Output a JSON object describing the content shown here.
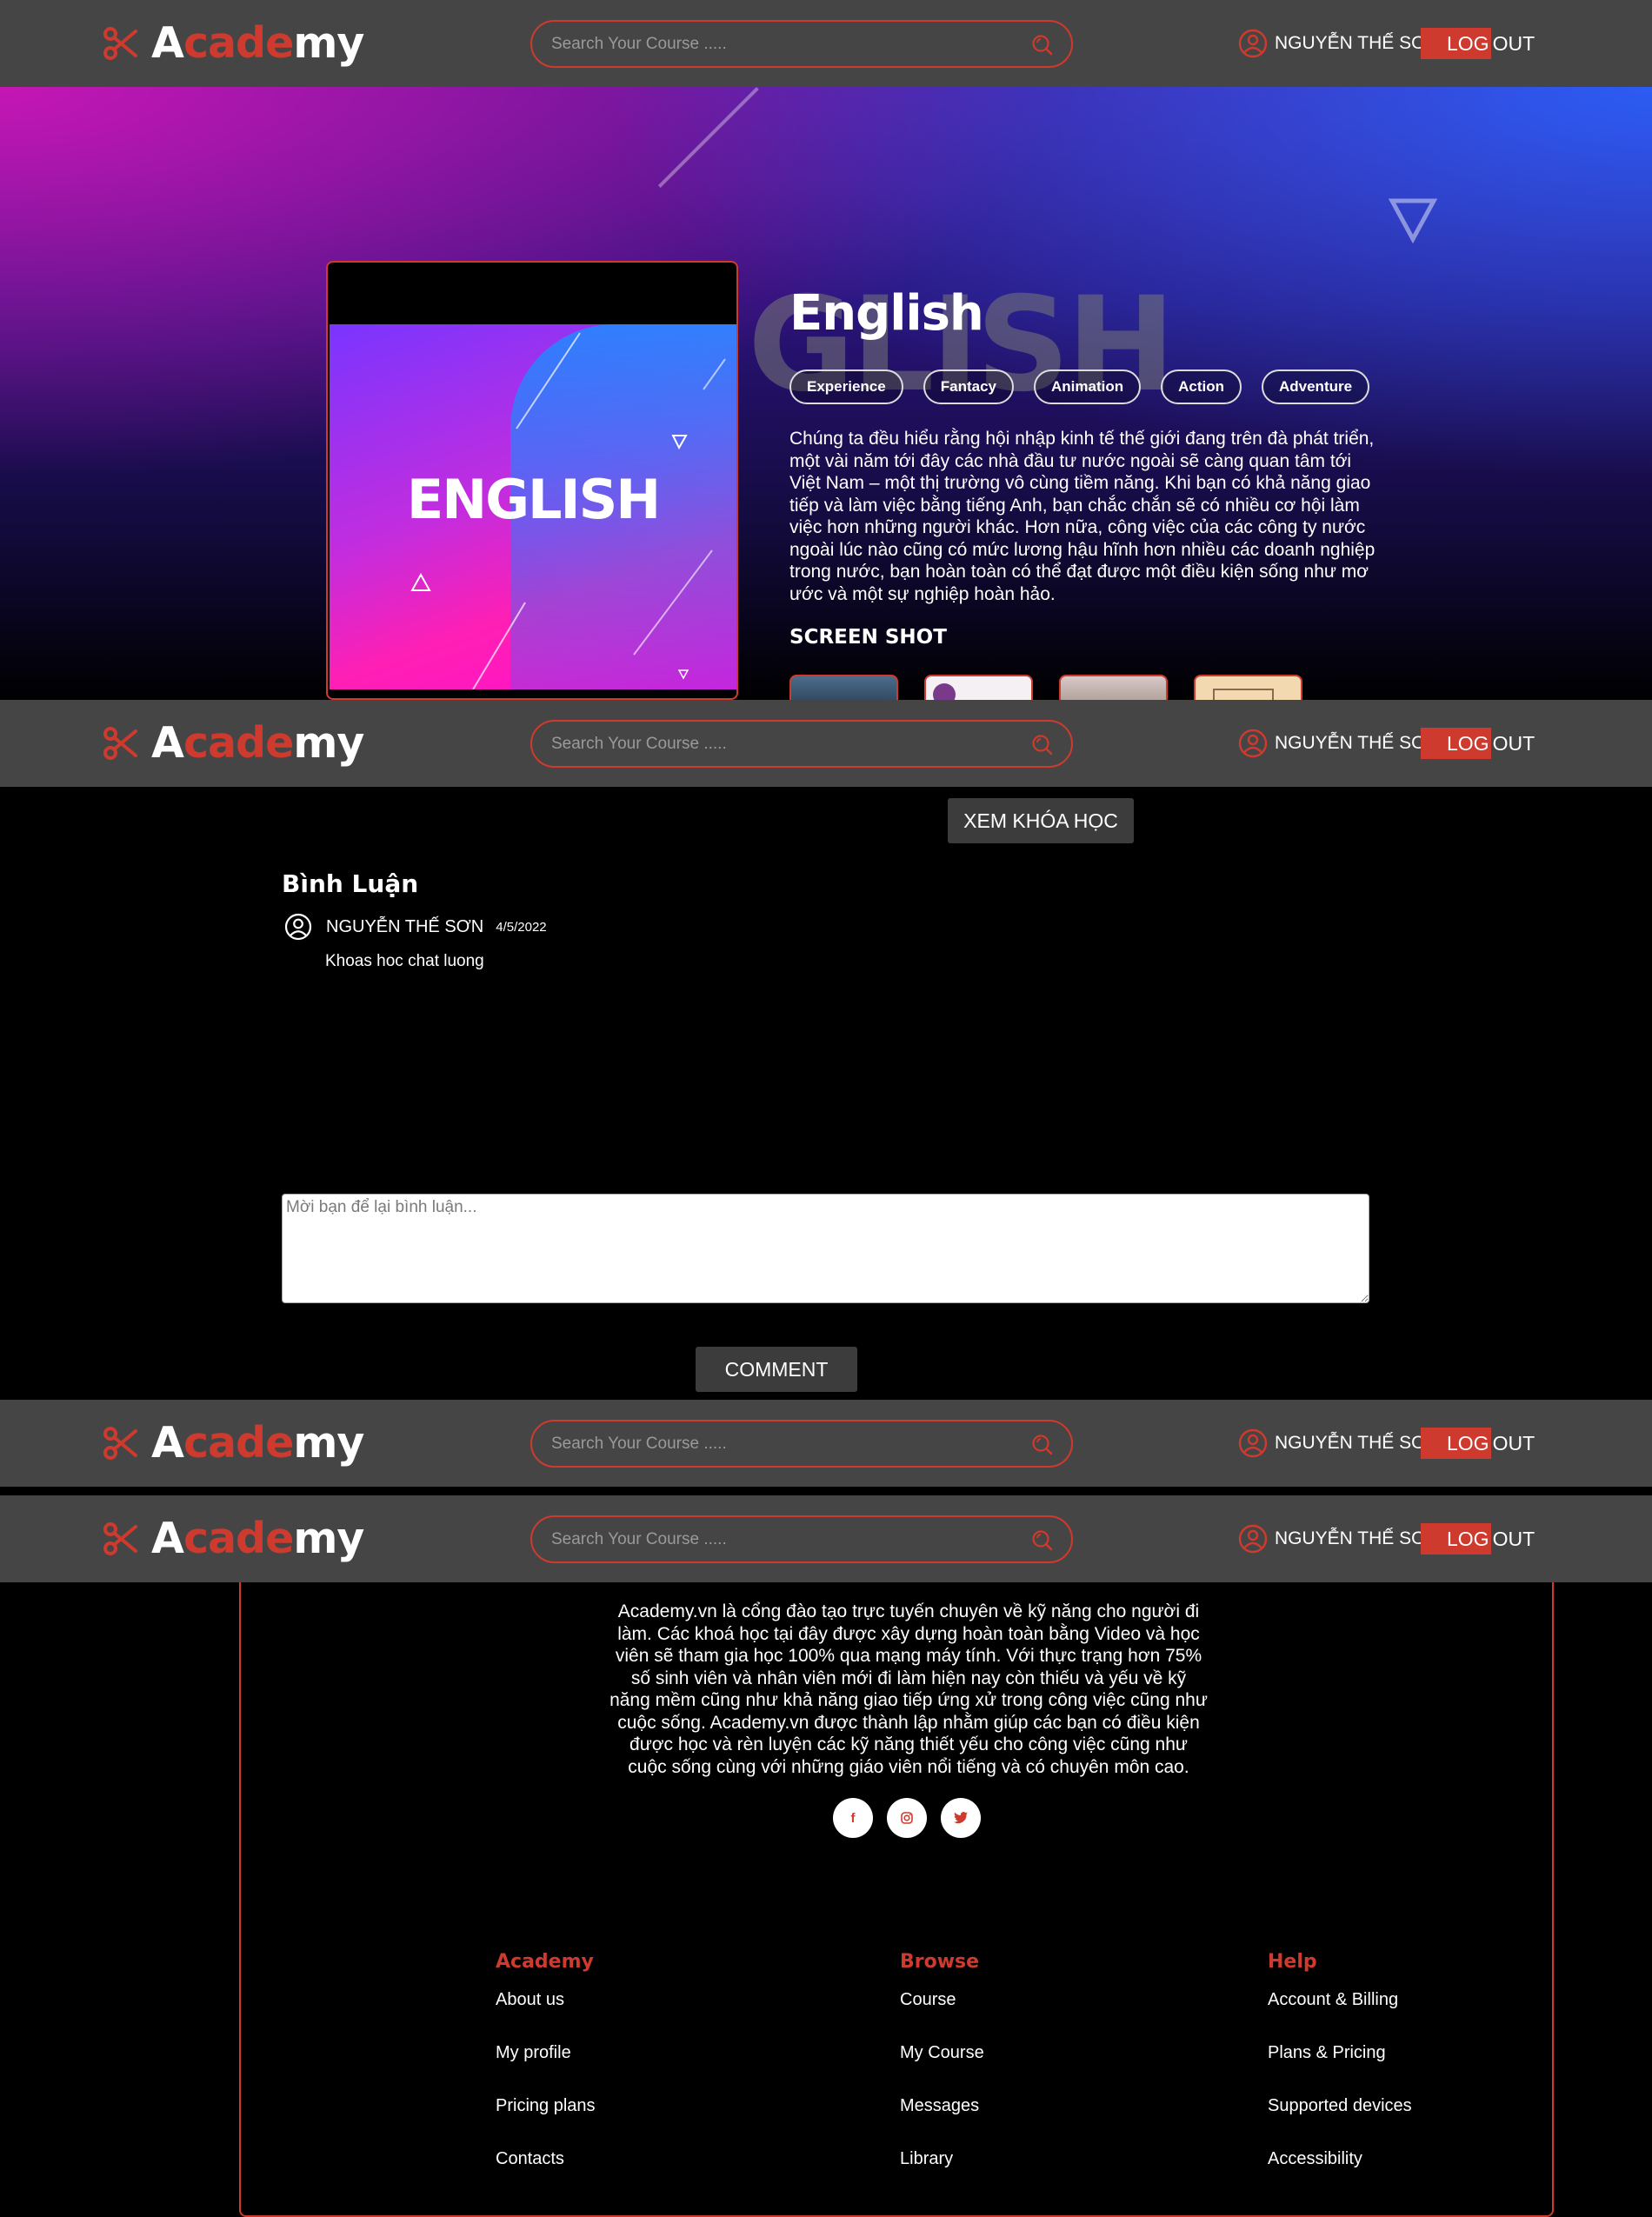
{
  "brand": {
    "logo_part1": "A",
    "logo_part2": "cade",
    "logo_part3": "my",
    "accent": "#cf3a2e",
    "header_bg": "#454545"
  },
  "header": {
    "search_placeholder": "Search Your Course .....",
    "user_name": "NGUYỄN THẾ SƠN",
    "logout_part1": "LOG",
    "logout_part2": "OUT"
  },
  "course": {
    "bg_word": "GLISH",
    "thumb_word": "ENGLISH",
    "title": "English",
    "tags": [
      "Experience",
      "Fantacy",
      "Animation",
      "Action",
      "Adventure"
    ],
    "description": "Chúng ta đều hiểu rằng hội nhập kinh tế thế giới đang trên đà phát triển, một vài năm tới đây các nhà đầu tư nước ngoài sẽ càng quan tâm tới Việt Nam – một thị trường vô cùng tiềm năng. Khi bạn có khả năng giao tiếp và làm việc bằng tiếng Anh, bạn chắc chắn sẽ có nhiều cơ hội làm việc hơn những người khác. Hơn nữa, công việc của các công ty nước ngoài lúc nào cũng có mức lương hậu hĩnh hơn nhiều các doanh nghiệp trong nước, bạn hoàn toàn có thể đạt được một điều kiện sống như mơ ước và một sự nghiệp hoàn hảo.",
    "screenshot_title": "SCREEN SHOT",
    "view_button": "XEM KHÓA HỌC"
  },
  "comments": {
    "title": "Bình Luận",
    "items": [
      {
        "author": "NGUYỄN THẾ SƠN",
        "date": "4/5/2022",
        "text": "Khoas hoc chat luong"
      }
    ],
    "input_placeholder": "Mời bạn để lại bình luận...",
    "submit_label": "COMMENT"
  },
  "footer": {
    "about": "Academy.vn là cổng đào tạo trực tuyến chuyên về kỹ năng cho người đi làm. Các khoá học tại đây được xây dựng hoàn toàn bằng Video và học viên sẽ tham gia học 100% qua mạng máy tính. Với thực trạng hơn 75% số sinh viên và nhân viên mới đi làm hiện nay còn thiếu và yếu về kỹ năng mềm cũng như khả năng giao tiếp ứng xử trong công việc cũng như cuộc sống. Academy.vn được thành lập nhằm giúp các bạn có điều kiện được học và rèn luyện các kỹ năng thiết yếu cho công việc cũng như cuộc sống cùng với những giáo viên nổi tiếng và có chuyên môn cao.",
    "socials": [
      "facebook-icon",
      "instagram-icon",
      "twitter-icon"
    ],
    "columns": [
      {
        "title": "Academy",
        "links": [
          "About us",
          "My profile",
          "Pricing plans",
          "Contacts"
        ]
      },
      {
        "title": "Browse",
        "links": [
          "Course",
          "My Course",
          "Messages",
          "Library"
        ]
      },
      {
        "title": "Help",
        "links": [
          "Account & Billing",
          "Plans & Pricing",
          "Supported devices",
          "Accessibility"
        ]
      }
    ]
  }
}
